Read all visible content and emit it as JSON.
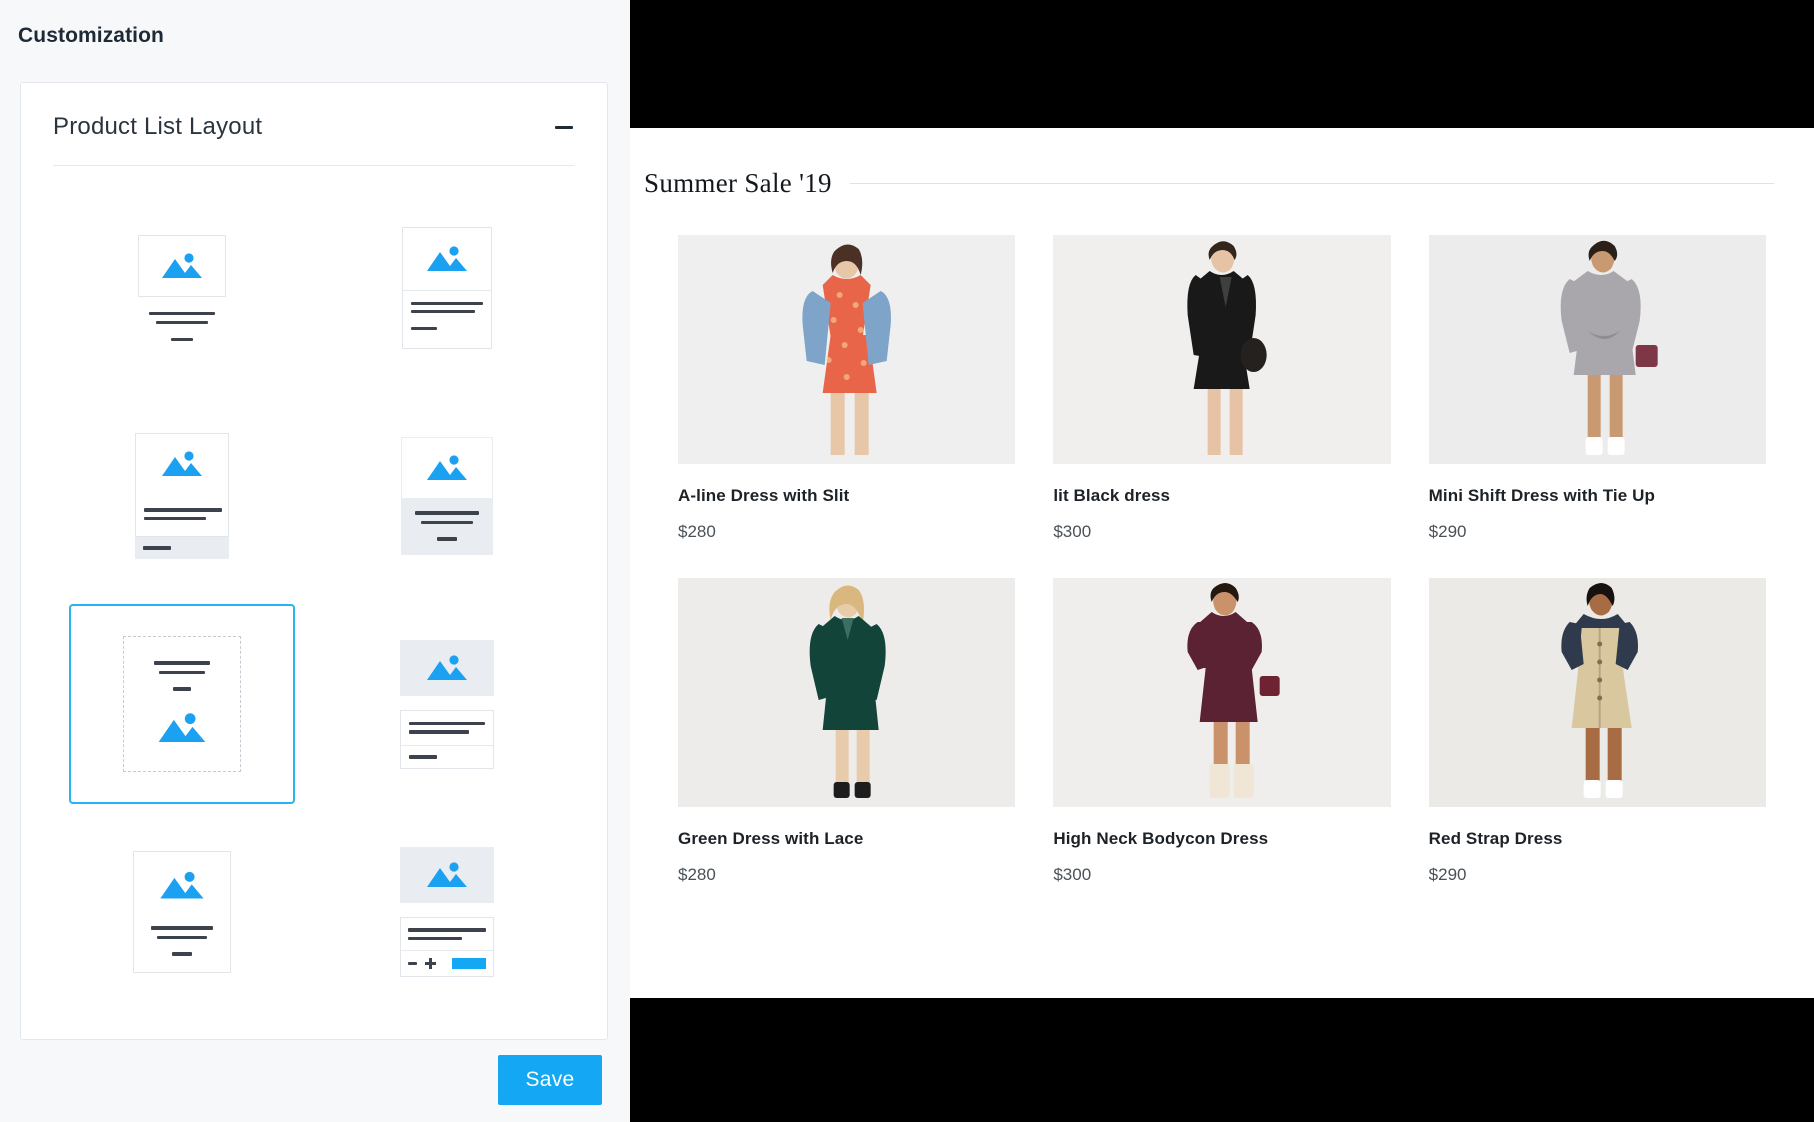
{
  "left_panel": {
    "page_title": "Customization",
    "section": {
      "title": "Product List Layout",
      "collapse_icon": "minus-icon"
    },
    "layout_options": [
      {
        "id": "opt-1",
        "name": "image-top-centered-text",
        "selected": false
      },
      {
        "id": "opt-2",
        "name": "boxed-image-left-text",
        "selected": false
      },
      {
        "id": "opt-3",
        "name": "bordered-card-left-text",
        "selected": false
      },
      {
        "id": "opt-4",
        "name": "grey-card-centered-text",
        "selected": false
      },
      {
        "id": "opt-5",
        "name": "text-above-image-dashed",
        "selected": true
      },
      {
        "id": "opt-6",
        "name": "grey-image-boxed-text",
        "selected": false
      },
      {
        "id": "opt-7",
        "name": "bordered-card-centered-text",
        "selected": false
      },
      {
        "id": "opt-8",
        "name": "grey-image-with-quantity-stepper",
        "selected": false
      }
    ],
    "save_label": "Save",
    "accent_color": "#14a7f3",
    "selected_border_color": "#29b3f0",
    "placeholder_icon_color": "#1ba1f2"
  },
  "preview": {
    "section_title": "Summer Sale '19",
    "products": [
      {
        "name": "A-line Dress with Slit",
        "price": "$280",
        "swatch": "#e8654a",
        "bg": "#efefef"
      },
      {
        "name": "lit Black dress",
        "price": "$300",
        "swatch": "#1b1b1b",
        "bg": "#f0efed"
      },
      {
        "name": "Mini Shift Dress with Tie Up",
        "price": "$290",
        "swatch": "#a9a7ac",
        "bg": "#ececec"
      },
      {
        "name": "Green Dress with Lace",
        "price": "$280",
        "swatch": "#13443a",
        "bg": "#eeecea"
      },
      {
        "name": "High Neck Bodycon Dress",
        "price": "$300",
        "swatch": "#5a2232",
        "bg": "#efeeec"
      },
      {
        "name": "Red Strap Dress",
        "price": "$290",
        "swatch": "#d9c79f",
        "bg": "#eceae6"
      }
    ]
  }
}
